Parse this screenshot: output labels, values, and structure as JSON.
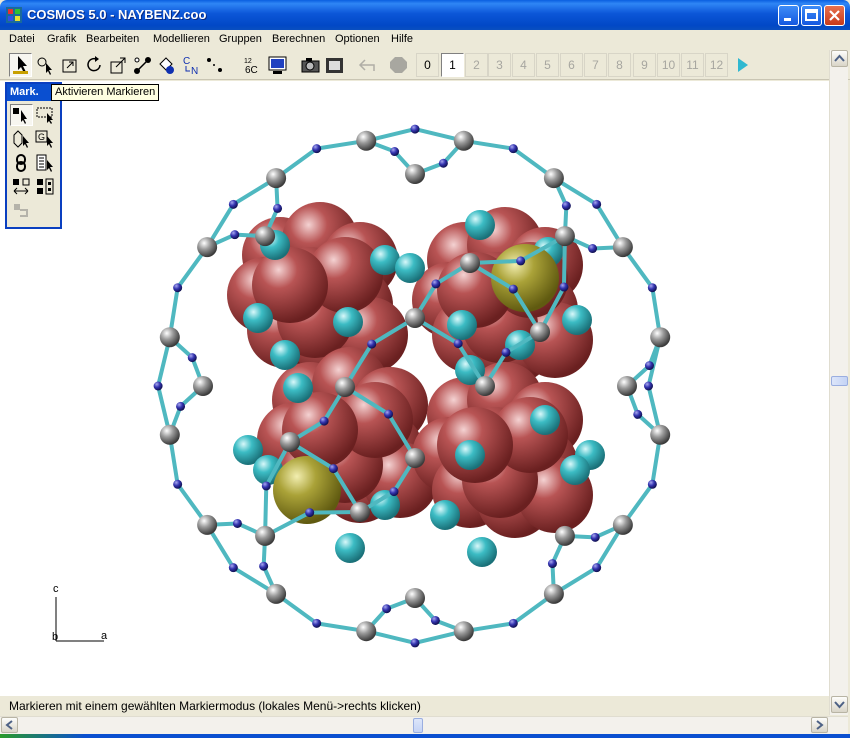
{
  "window": {
    "title": "COSMOS 5.0 - NAYBENZ.coo"
  },
  "menu": [
    {
      "label": "Datei"
    },
    {
      "label": "Grafik"
    },
    {
      "label": "Bearbeiten"
    },
    {
      "label": "Modellieren"
    },
    {
      "label": "Gruppen"
    },
    {
      "label": "Berechnen"
    },
    {
      "label": "Optionen"
    },
    {
      "label": "Hilfe"
    }
  ],
  "toolbar": {
    "element_label_top": "12",
    "element_label_main": "6C",
    "cn_label_top": "C",
    "cn_label_bottom": "N",
    "numbers": [
      "0",
      "1",
      "2",
      "3",
      "4",
      "5",
      "6",
      "7",
      "8",
      "9",
      "10",
      "11",
      "12"
    ],
    "active_number": "1"
  },
  "palette": {
    "title": "Mark.",
    "tooltip": "Aktivieren Markieren",
    "g_label": "G"
  },
  "axes": {
    "c": "c",
    "b": "b",
    "a": "a"
  },
  "status": {
    "text": "Markieren mit einem gewählten Markiermodus (lokales Menü->rechts klicken)"
  },
  "colors": {
    "framework_bond": "#4fb8c0",
    "si_atom": "#9a9a9a",
    "o_atom": "#2a2aa0",
    "guest_atom": "#b04848",
    "hydrogen": "#3fb8c0",
    "sodium": "#a8a030"
  }
}
